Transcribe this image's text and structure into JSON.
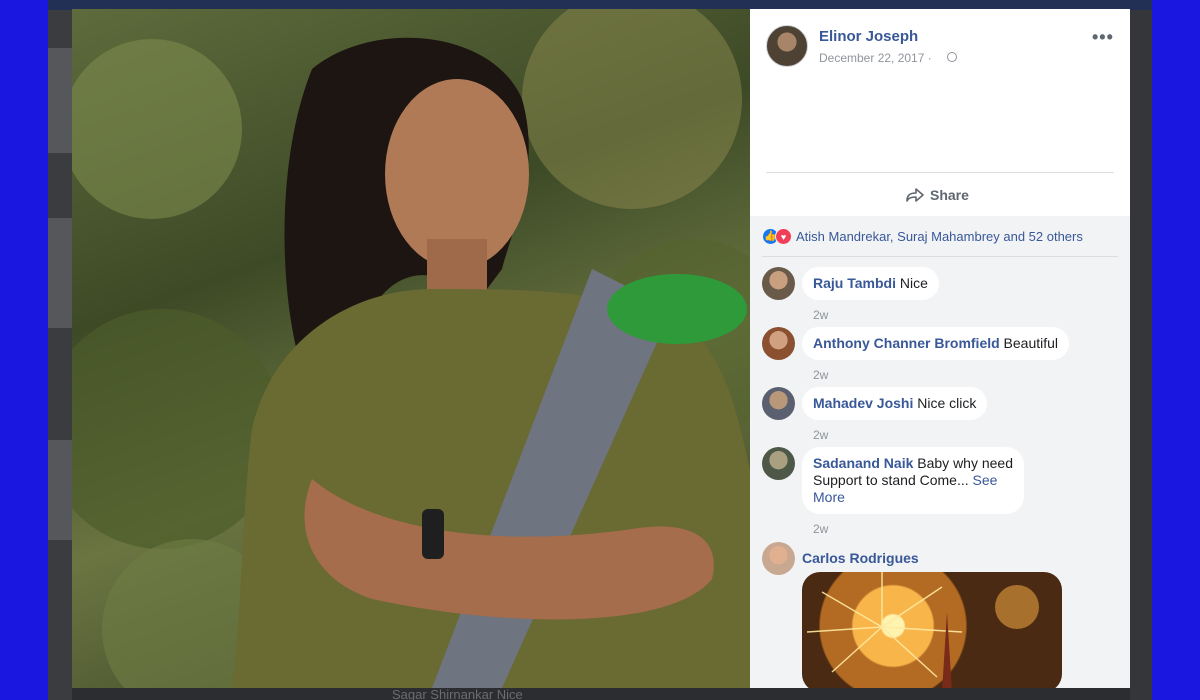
{
  "post": {
    "author": "Elinor Joseph",
    "date": "December 22, 2017 · ",
    "more": "•••",
    "share_label": "Share"
  },
  "reactions": {
    "summary": "Atish Mandrekar, Suraj Mahambrey and 52 others"
  },
  "comments": [
    {
      "name": "Raju Tambdi",
      "text": " Nice",
      "time": "2w"
    },
    {
      "name": "Anthony Channer Bromfield",
      "text": " Beautiful",
      "time": "2w"
    },
    {
      "name": "Mahadev Joshi",
      "text": " Nice click",
      "time": "2w"
    },
    {
      "name": "Sadanand Naik",
      "text": " Baby why need Support to stand Come...",
      "see_more": "See More",
      "time": "2w"
    },
    {
      "name": "Carlos Rodrigues"
    }
  ],
  "background": {
    "bottom_text": "Sagar Shirnankar Nice"
  },
  "colors": {
    "frame": "#1a18e0",
    "link": "#385898",
    "like": "#1877f2",
    "love": "#f33e58"
  },
  "icons": {
    "like": "thumbs-up-icon",
    "love": "heart-icon",
    "share": "share-arrow-icon",
    "more": "more-options-icon",
    "privacy": "globe-icon"
  }
}
